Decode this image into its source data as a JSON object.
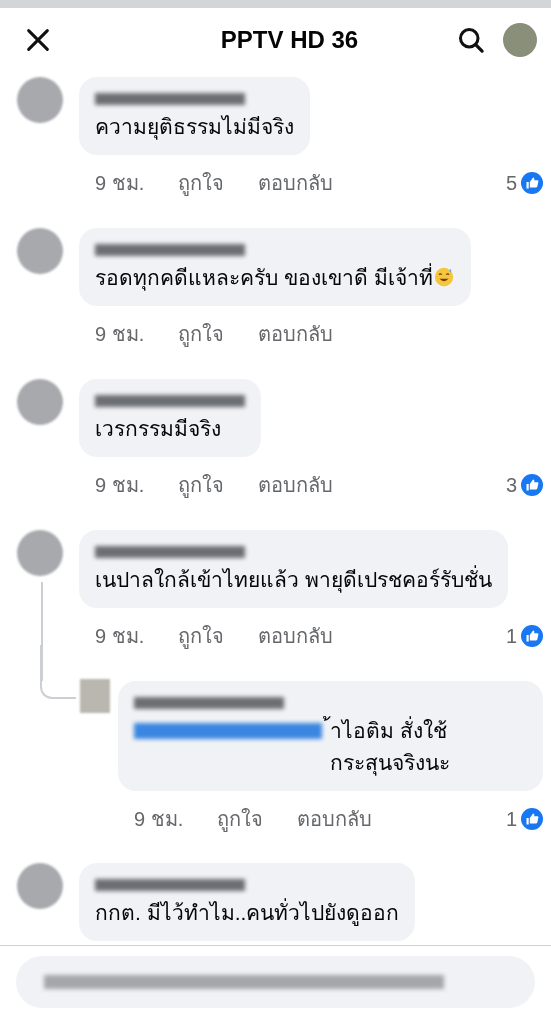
{
  "header": {
    "title": "PPTV HD 36"
  },
  "comments": [
    {
      "text": "ความยุติธรรมไม่มีจริง",
      "time": "9 ชม.",
      "like_label": "ถูกใจ",
      "reply_label": "ตอบกลับ",
      "reaction_count": "5"
    },
    {
      "text": "รอดทุกคดีแหละครับ ของเขาดี มีเจ้าที่",
      "time": "9 ชม.",
      "like_label": "ถูกใจ",
      "reply_label": "ตอบกลับ",
      "emoji": true
    },
    {
      "text": "เวรกรรมมีจริง",
      "time": "9 ชม.",
      "like_label": "ถูกใจ",
      "reply_label": "ตอบกลับ",
      "reaction_count": "3"
    },
    {
      "text": "เนปาลใกล้เข้าไทยแล้ว พายุดีเปรชคอร์รับชั่น",
      "time": "9 ชม.",
      "like_label": "ถูกใจ",
      "reply_label": "ตอบกลับ",
      "reaction_count": "1",
      "replies": [
        {
          "text": "้าไอติม สั่งใช้กระสุนจริงนะ",
          "mention": true,
          "time": "9 ชม.",
          "like_label": "ถูกใจ",
          "reply_label": "ตอบกลับ",
          "reaction_count": "1"
        }
      ]
    },
    {
      "text": "กกต. มีไว้ทำไม..คนทั่วไปยังดูออก"
    }
  ]
}
